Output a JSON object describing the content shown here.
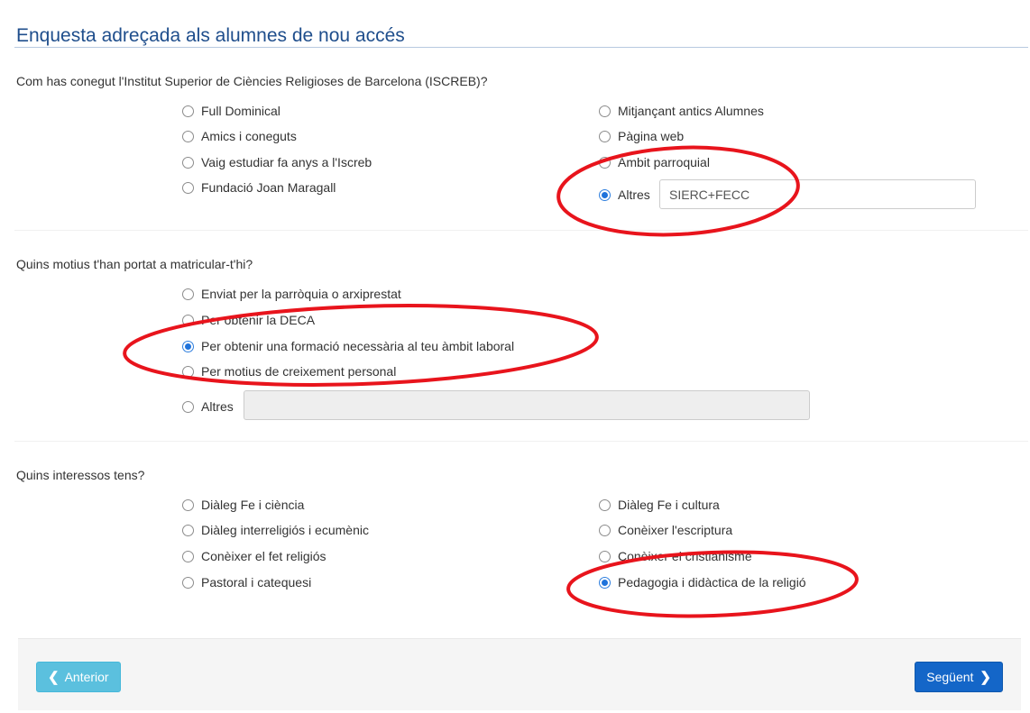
{
  "title": "Enquesta adreçada als alumnes de nou accés",
  "q1": {
    "label": "Com has conegut l'Institut Superior de Ciències Religioses de Barcelona (ISCREB)?",
    "options": [
      {
        "label": "Full Dominical",
        "checked": false
      },
      {
        "label": "Amics i coneguts",
        "checked": false
      },
      {
        "label": "Vaig estudiar fa anys a l'Iscreb",
        "checked": false
      },
      {
        "label": "Fundació Joan Maragall",
        "checked": false
      },
      {
        "label": "Mitjançant antics Alumnes",
        "checked": false
      },
      {
        "label": "Pàgina web",
        "checked": false
      },
      {
        "label": "Àmbit parroquial",
        "checked": false
      },
      {
        "label": "Altres",
        "checked": true
      }
    ],
    "other_value": "SIERC+FECC"
  },
  "q2": {
    "label": "Quins motius t'han portat a matricular-t'hi?",
    "options": [
      {
        "label": "Enviat per la parròquia o arxiprestat",
        "checked": false
      },
      {
        "label": "Per obtenir la DECA",
        "checked": false
      },
      {
        "label": "Per obtenir una formació necessària al teu àmbit laboral",
        "checked": true
      },
      {
        "label": "Per motius de creixement personal",
        "checked": false
      },
      {
        "label": "Altres",
        "checked": false
      }
    ],
    "other_value": ""
  },
  "q3": {
    "label": "Quins interessos tens?",
    "options": [
      {
        "label": "Diàleg Fe i ciència",
        "checked": false
      },
      {
        "label": "Diàleg interreligiós i ecumènic",
        "checked": false
      },
      {
        "label": "Conèixer el fet religiós",
        "checked": false
      },
      {
        "label": "Pastoral i catequesi",
        "checked": false
      },
      {
        "label": "Diàleg Fe i cultura",
        "checked": false
      },
      {
        "label": "Conèixer l'escriptura",
        "checked": false
      },
      {
        "label": "Conèixer el cristianisme",
        "checked": false
      },
      {
        "label": "Pedagogia i didàctica de la religió",
        "checked": true
      }
    ]
  },
  "footer": {
    "prev_label": "Anterior",
    "next_label": "Següent"
  },
  "colors": {
    "title": "#1f4e8c",
    "radio_checked": "#1f73db",
    "btn_prev": "#5bc0de",
    "btn_next": "#1466c8",
    "annotation": "#e8141c"
  }
}
